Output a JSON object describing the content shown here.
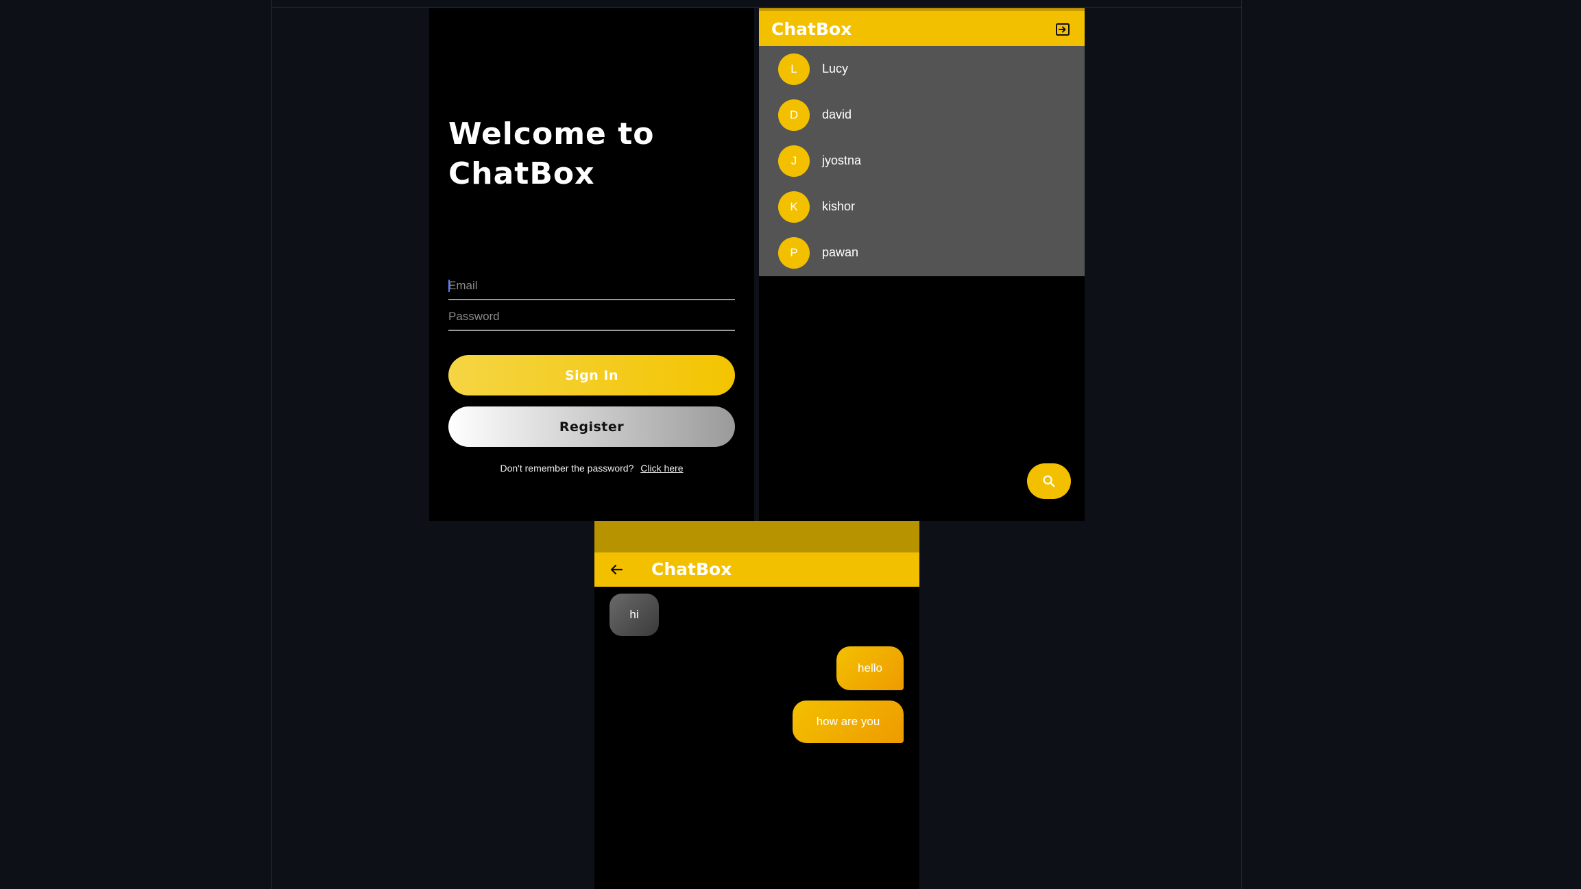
{
  "login": {
    "welcome": "Welcome to ChatBox",
    "email_placeholder": "Email",
    "password_placeholder": "Password",
    "signin_label": "Sign In",
    "register_label": "Register",
    "forgot_text": "Don't remember the password?",
    "forgot_link": "Click here"
  },
  "users": {
    "title": "ChatBox",
    "items": [
      {
        "initial": "L",
        "name": "Lucy"
      },
      {
        "initial": "D",
        "name": "david"
      },
      {
        "initial": "J",
        "name": "jyostna"
      },
      {
        "initial": "K",
        "name": "kishor"
      },
      {
        "initial": "P",
        "name": "pawan"
      }
    ],
    "logout_icon": "logout-icon",
    "fab_icon": "search-icon"
  },
  "chat": {
    "title": "ChatBox",
    "back_icon": "arrow-left-icon",
    "messages": [
      {
        "text": "hi",
        "direction": "incoming"
      },
      {
        "text": "hello",
        "direction": "outgoing"
      },
      {
        "text": "how are you",
        "direction": "outgoing"
      }
    ]
  },
  "colors": {
    "accent": "#f3c000",
    "accent_dark": "#b89300",
    "page_bg": "#0d1117",
    "list_bg": "#545454"
  }
}
